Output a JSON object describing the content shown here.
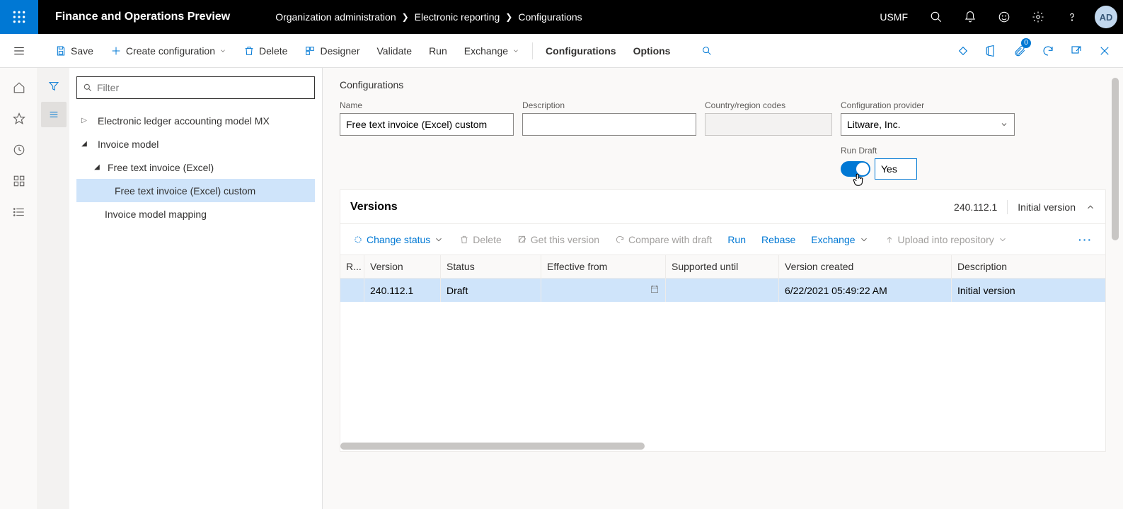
{
  "header": {
    "app_title": "Finance and Operations Preview",
    "breadcrumb": [
      "Organization administration",
      "Electronic reporting",
      "Configurations"
    ],
    "company": "USMF",
    "avatar": "AD",
    "badge_count": "0"
  },
  "actionbar": {
    "save": "Save",
    "create_config": "Create configuration",
    "delete": "Delete",
    "designer": "Designer",
    "validate": "Validate",
    "run": "Run",
    "exchange": "Exchange",
    "configurations": "Configurations",
    "options": "Options"
  },
  "tree": {
    "filter_placeholder": "Filter",
    "items": [
      {
        "label": "Electronic ledger accounting model MX",
        "level": 0,
        "exp": "▷"
      },
      {
        "label": "Invoice model",
        "level": 1,
        "exp": "◢"
      },
      {
        "label": "Free text invoice (Excel)",
        "level": 2,
        "exp": "◢"
      },
      {
        "label": "Free text invoice (Excel) custom",
        "level": 3,
        "exp": "",
        "selected": true
      },
      {
        "label": "Invoice model mapping",
        "level": 2,
        "exp": ""
      }
    ]
  },
  "form": {
    "section": "Configurations",
    "name_label": "Name",
    "name_value": "Free text invoice (Excel) custom",
    "desc_label": "Description",
    "desc_value": "",
    "country_label": "Country/region codes",
    "country_value": "",
    "provider_label": "Configuration provider",
    "provider_value": "Litware, Inc.",
    "rundraft_label": "Run Draft",
    "rundraft_value": "Yes"
  },
  "versions": {
    "title": "Versions",
    "header_version": "240.112.1",
    "header_desc": "Initial version",
    "toolbar": {
      "change_status": "Change status",
      "delete": "Delete",
      "get_version": "Get this version",
      "compare": "Compare with draft",
      "run": "Run",
      "rebase": "Rebase",
      "exchange": "Exchange",
      "upload": "Upload into repository"
    },
    "columns": {
      "r": "R...",
      "version": "Version",
      "status": "Status",
      "effective": "Effective from",
      "supported": "Supported until",
      "created": "Version created",
      "desc": "Description"
    },
    "rows": [
      {
        "version": "240.112.1",
        "status": "Draft",
        "effective": "",
        "supported": "",
        "created": "6/22/2021 05:49:22 AM",
        "desc": "Initial version"
      }
    ]
  }
}
